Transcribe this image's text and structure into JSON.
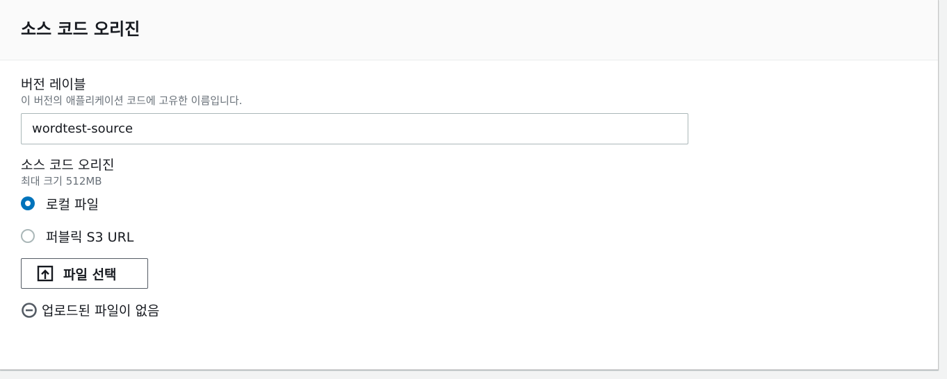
{
  "panel": {
    "title": "소스 코드 오리진"
  },
  "version_label": {
    "label": "버전 레이블",
    "description": "이 버전의 애플리케이션 코드에 고유한 이름입니다.",
    "value": "wordtest-source"
  },
  "source_origin": {
    "label": "소스 코드 오리진",
    "description": "최대 크기 512MB",
    "options": [
      {
        "label": "로컬 파일",
        "selected": true
      },
      {
        "label": "퍼블릭 S3 URL",
        "selected": false
      }
    ]
  },
  "file_select": {
    "button_label": "파일 선택",
    "icon": "upload-icon"
  },
  "upload_status": {
    "icon": "minus-circle-icon",
    "text": "업로드된 파일이 없음"
  },
  "colors": {
    "accent": "#0073bb",
    "text": "#16191f",
    "muted": "#687078",
    "border": "#aab7b8"
  }
}
